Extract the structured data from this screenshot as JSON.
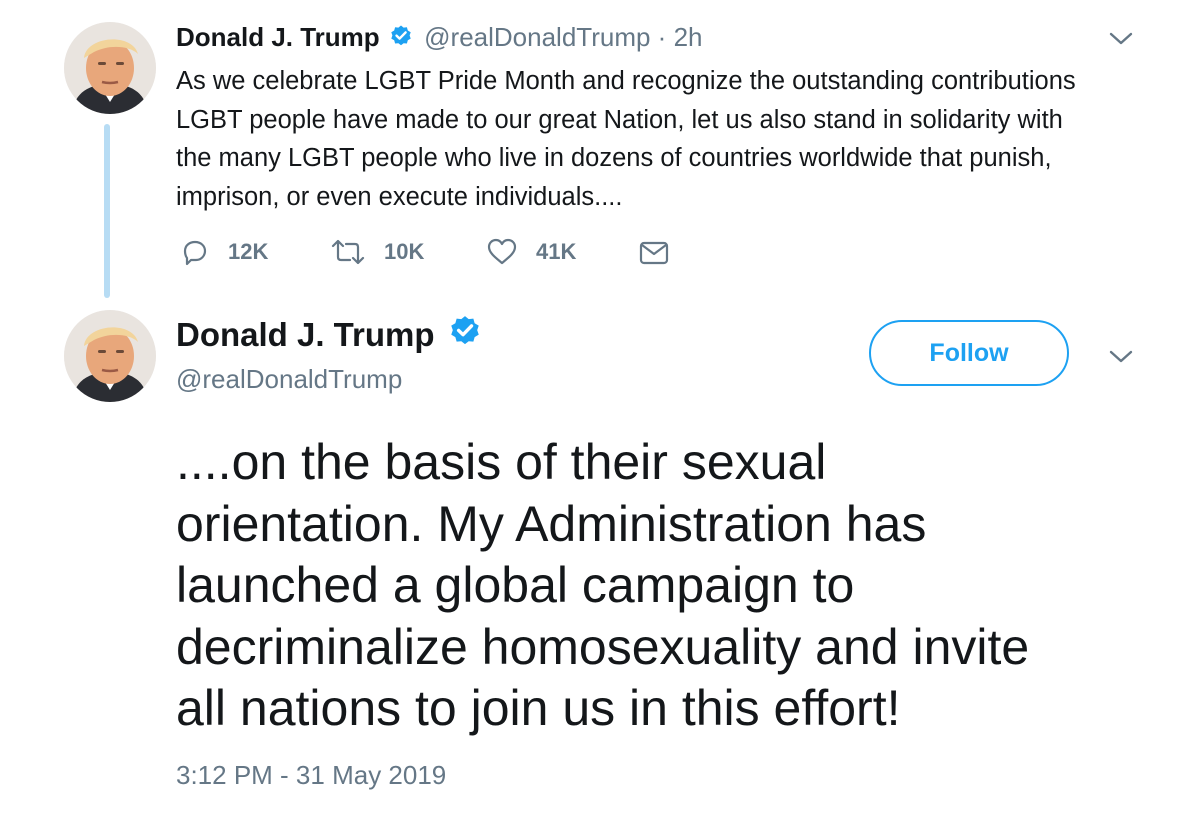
{
  "tweet1": {
    "author_name": "Donald J. Trump",
    "handle": "@realDonaldTrump",
    "separator": " · ",
    "time": "2h",
    "text_lines": [
      "As we celebrate LGBT Pride Month and recognize the outstanding contributions",
      "LGBT people have made to our great Nation, let us also stand in solidarity with",
      "the many LGBT people who live in dozens of countries worldwide that punish,",
      "imprison, or even execute individuals...."
    ],
    "actions": {
      "reply_count": "12K",
      "retweet_count": "10K",
      "like_count": "41K"
    }
  },
  "tweet2": {
    "author_name": "Donald J. Trump",
    "handle": "@realDonaldTrump",
    "follow_label": "Follow",
    "text_lines": [
      "....on the basis of their sexual",
      "orientation. My Administration has",
      "launched a global campaign to",
      "decriminalize homosexuality and invite",
      "all nations to join us in this effort!"
    ],
    "timestamp": "3:12 PM - 31 May 2019"
  },
  "colors": {
    "accent": "#1da1f2",
    "thread_line": "#b7dcf4",
    "muted": "#657786",
    "text": "#14171a"
  },
  "icons": [
    "avatar",
    "verified-badge-icon",
    "chevron-down-icon",
    "reply-icon",
    "retweet-icon",
    "like-icon",
    "direct-message-icon"
  ]
}
